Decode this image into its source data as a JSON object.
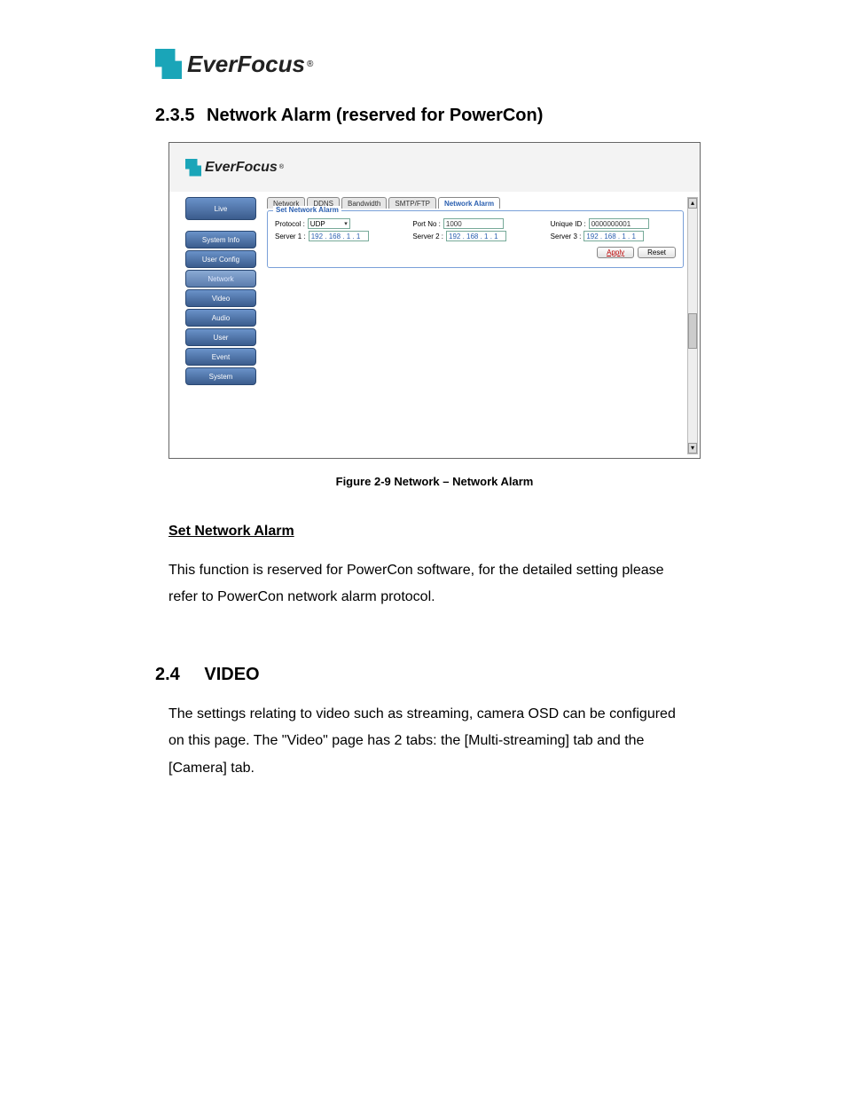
{
  "header_brand": {
    "text": "EverFocus",
    "reg": "®"
  },
  "section_235": {
    "number": "2.3.5",
    "title": "Network Alarm (reserved for PowerCon)"
  },
  "panel": {
    "brand": {
      "text": "EverFocus",
      "reg": "®"
    },
    "sidebar": {
      "items": [
        "Live",
        "System Info",
        "User Config",
        "Network",
        "Video",
        "Audio",
        "User",
        "Event",
        "System"
      ],
      "active_index": 3
    },
    "tabs": {
      "items": [
        "Network",
        "DDNS",
        "Bandwidth",
        "SMTP/FTP",
        "Network Alarm"
      ],
      "active_index": 4
    },
    "fieldset_legend": "Set Network Alarm",
    "fields": {
      "protocol": {
        "label": "Protocol :",
        "value": "UDP"
      },
      "port_no": {
        "label": "Port No :",
        "value": "1000"
      },
      "unique_id": {
        "label": "Unique ID :",
        "value": "0000000001"
      },
      "server1": {
        "label": "Server 1 :",
        "value": "192 . 168 .  1  .  1"
      },
      "server2": {
        "label": "Server 2 :",
        "value": "192 . 168 .  1  .  1"
      },
      "server3": {
        "label": "Server 3 :",
        "value": "192 . 168 .  1  .  1"
      }
    },
    "buttons": {
      "apply": "Apply",
      "reset": "Reset"
    }
  },
  "figure_caption": "Figure 2-9 Network – Network Alarm",
  "subhead": "Set Network Alarm",
  "paragraph_235": "This function is reserved for PowerCon software, for the detailed setting please refer to PowerCon network alarm protocol.",
  "section_24": {
    "number": "2.4",
    "title": "VIDEO"
  },
  "paragraph_24": "The settings relating to video such as streaming, camera OSD can be configured on this page.   The \"Video\" page has 2 tabs: the [Multi-streaming] tab and the [Camera] tab."
}
